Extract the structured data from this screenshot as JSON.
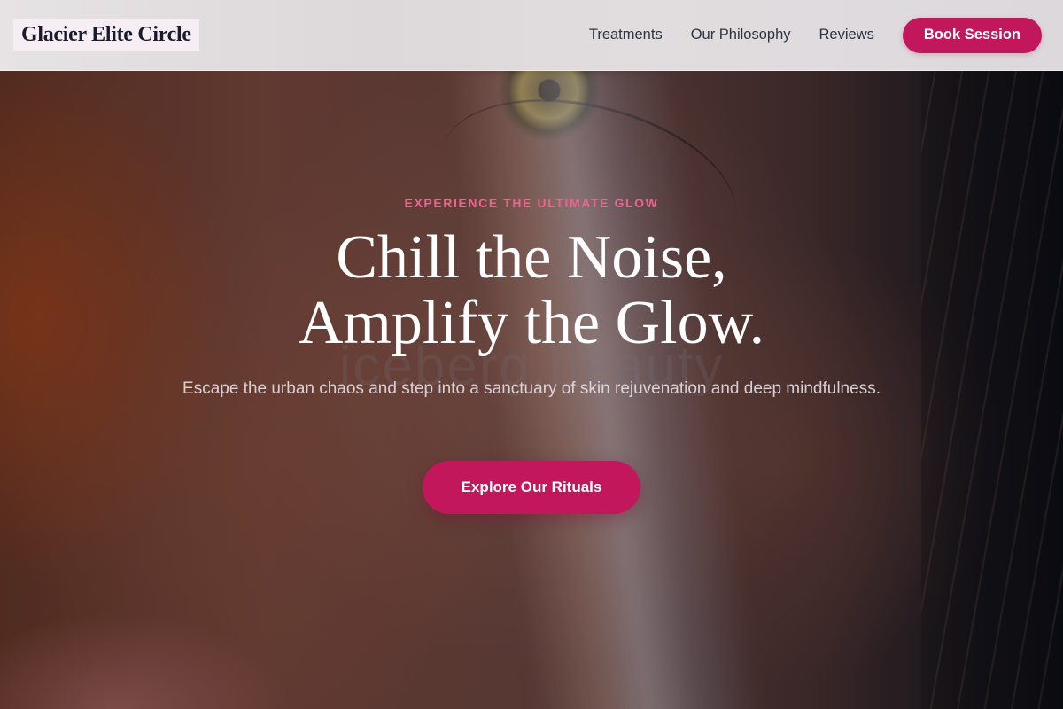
{
  "nav": {
    "brand": "Glacier Elite Circle",
    "links": [
      "Treatments",
      "Our Philosophy",
      "Reviews"
    ],
    "cta_label": "Book Session"
  },
  "hero": {
    "eyebrow": "EXPERIENCE THE ULTIMATE GLOW",
    "headline_line1": "Chill the Noise,",
    "headline_line2": "Amplify the Glow.",
    "subtitle": "Escape the urban chaos and step into a sanctuary of skin rejuvenation and deep mindfulness.",
    "cta_label": "Explore Our Rituals",
    "watermark": "iceberg.beauty"
  },
  "colors": {
    "accent": "#c2185b",
    "eyebrow": "#f06292",
    "brand_text": "#1a1a2e",
    "nav_text": "#2d3440"
  }
}
